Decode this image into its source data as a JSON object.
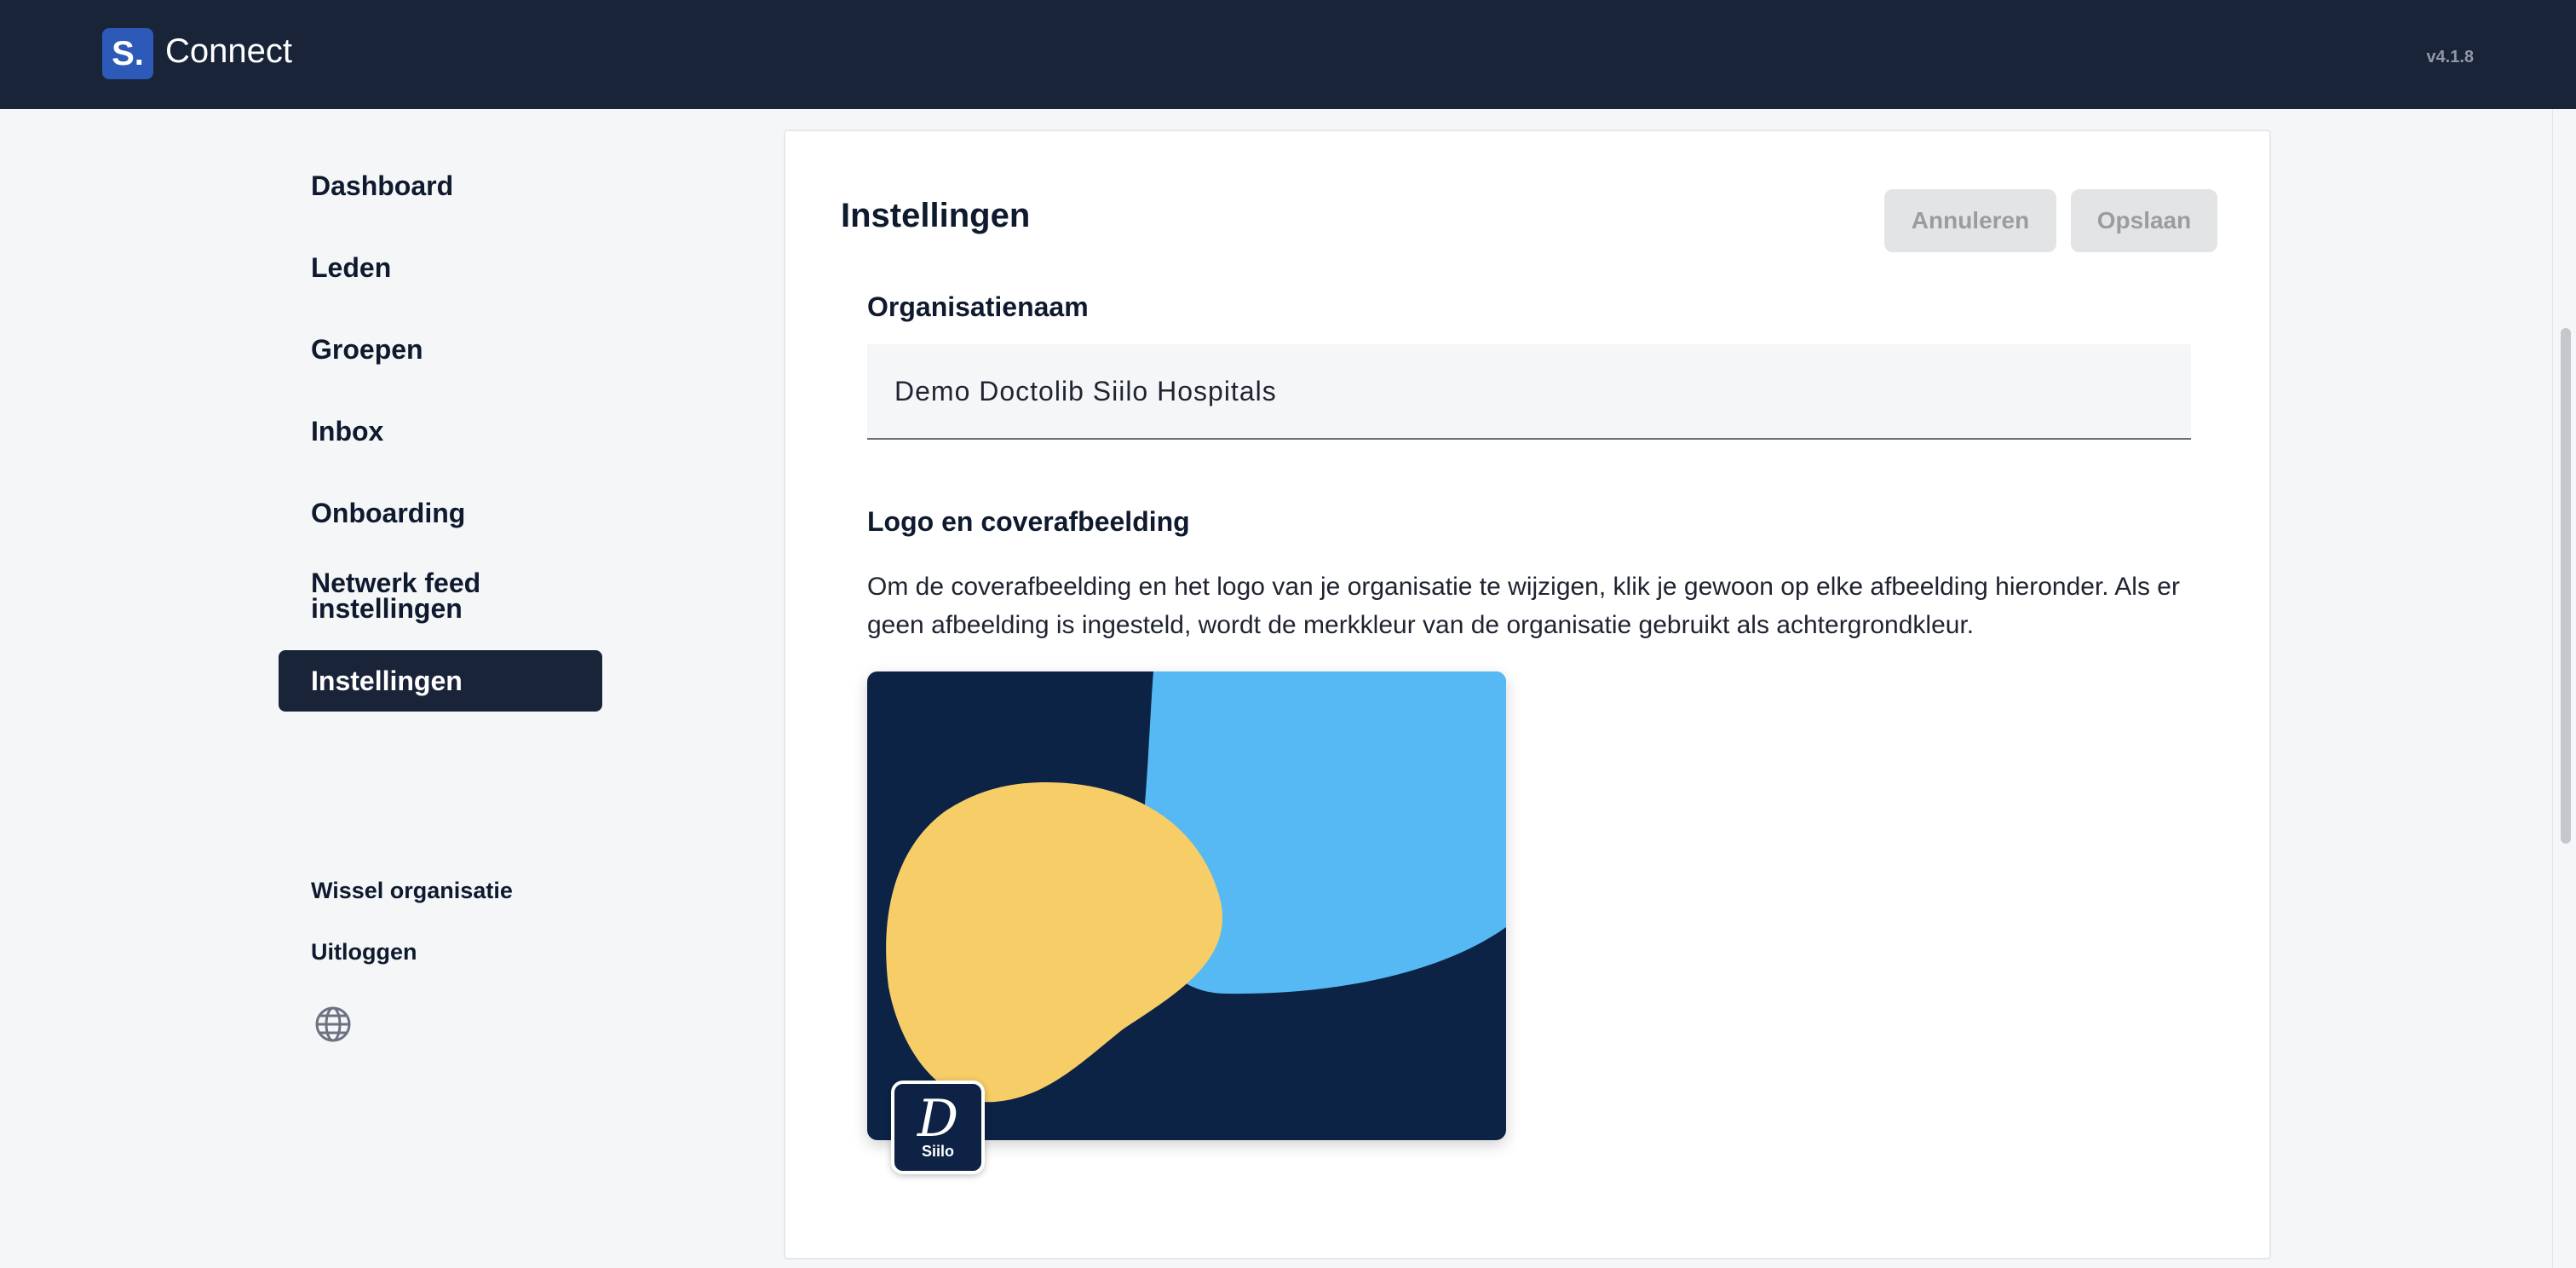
{
  "header": {
    "logo_letter": "S.",
    "app_name": "Connect",
    "version": "v4.1.8"
  },
  "sidebar": {
    "items": [
      {
        "label": "Dashboard"
      },
      {
        "label": "Leden"
      },
      {
        "label": "Groepen"
      },
      {
        "label": "Inbox"
      },
      {
        "label": "Onboarding"
      },
      {
        "label": "Netwerk feed instellingen"
      },
      {
        "label": "Instellingen",
        "active": true
      }
    ],
    "switch_org": "Wissel organisatie",
    "logout": "Uitloggen",
    "language_icon": "globe-icon"
  },
  "settings": {
    "title": "Instellingen",
    "cancel_label": "Annuleren",
    "save_label": "Opslaan",
    "org_name_label": "Organisatienaam",
    "org_name_value": "Demo Doctolib Siilo Hospitals",
    "media_label": "Logo en coverafbeelding",
    "media_description": "Om de coverafbeelding en het logo van je organisatie te wijzigen, klik je gewoon op elke afbeelding hieronder. Als er geen afbeelding is ingesteld, wordt de merkkleur van de organisatie gebruikt als achtergrondkleur.",
    "logo_glyph": "D",
    "logo_text": "Siilo"
  },
  "colors": {
    "header_bg": "#192438",
    "brand_blue": "#2d5ab8",
    "cover_navy": "#0c2346",
    "cover_sky": "#56b9f4",
    "cover_yellow": "#f6cd66",
    "disabled_button": "#e3e4e6"
  }
}
